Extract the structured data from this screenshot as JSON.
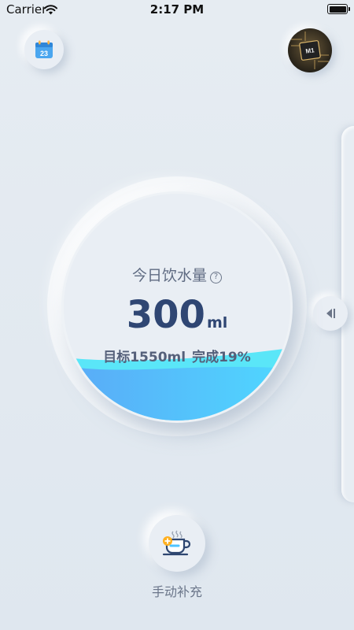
{
  "status_bar": {
    "carrier": "Carrier",
    "time": "2:17 PM"
  },
  "calendar": {
    "day": "23",
    "icon": "calendar-icon"
  },
  "avatar": {
    "chip_label": "M1"
  },
  "water": {
    "title": "今日饮水量",
    "amount": "300",
    "unit": "ml",
    "goal_text": "目标1550ml",
    "progress_text": "完成19%",
    "progress_fraction": 0.19
  },
  "manual_add": {
    "label": "手动补充",
    "icon": "cup-add-icon"
  },
  "colors": {
    "background": "#e3eaf1",
    "wave_front": "#4fc3ff",
    "wave_back": "#56e3f7",
    "title_text": "#2f4673"
  }
}
